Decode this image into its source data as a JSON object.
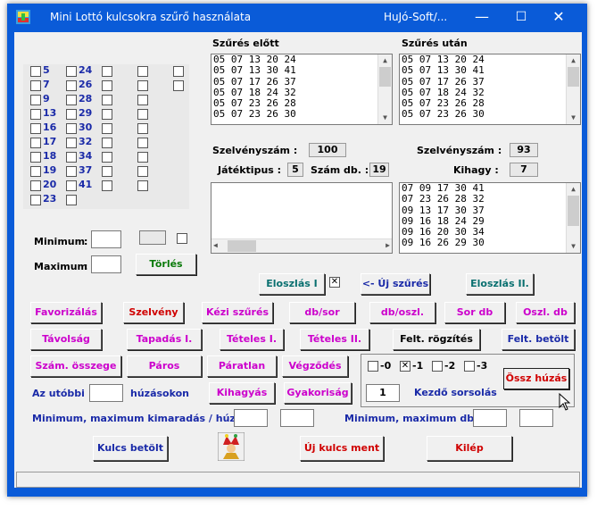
{
  "window": {
    "title": "Mini Lottó kulcsokra szűrő használata",
    "title_right": "HuJó-Soft/...",
    "minimize": "—",
    "maximize": "☐",
    "close": "✕"
  },
  "numbers_col1": [
    "5",
    "7",
    "9",
    "13",
    "16",
    "17",
    "18",
    "19",
    "20",
    "23"
  ],
  "numbers_col2": [
    "24",
    "26",
    "28",
    "29",
    "30",
    "32",
    "34",
    "37",
    "41"
  ],
  "filter_before": {
    "label": "Szűrés előtt",
    "rows": [
      "05 07 13 20 24",
      "05 07 13 30 41",
      "05 07 17 26 37",
      "05 07 18 24 32",
      "05 07 23 26 28",
      "05 07 23 26 30"
    ]
  },
  "filter_after": {
    "label": "Szűrés után",
    "rows": [
      "05 07 13 20 24",
      "05 07 13 30 41",
      "05 07 17 26 37",
      "05 07 18 24 32",
      "05 07 23 26 28",
      "05 07 23 26 30"
    ]
  },
  "stats": {
    "ticket_count_label": "Szelvényszám :",
    "ticket_count_before": "100",
    "game_type_label": "Játéktipus :",
    "game_type": "5",
    "num_count_label": "Szám db. :",
    "num_count": "19",
    "ticket_count_after_label": "Szelvényszám :",
    "ticket_count_after": "93",
    "skip_label": "Kihagy :",
    "skip": "7"
  },
  "skipped_list": [
    "07 09 17 30 41",
    "07 23 26 28 32",
    "09 13 17 30 37",
    "09 16 18 24 29",
    "09 16 20 30 34",
    "09 16 26 29 30"
  ],
  "minmax": {
    "min_label": "Minimum",
    "colon": ":",
    "max_label": "Maximum"
  },
  "buttons": {
    "torles": "Törlés",
    "eloszlas1": "Eloszlás I",
    "uj_szures": "<- Új szűrés",
    "eloszlas2": "Eloszlás II.",
    "favorizalas": "Favorizálás",
    "szelveny": "Szelvény",
    "kezi_szures": "Kézi szűrés",
    "db_sor": "db/sor",
    "db_oszl": "db/oszl.",
    "sor_db": "Sor db",
    "oszl_db": "Oszl. db",
    "tavolsag": "Távolság",
    "tapadas": "Tapadás I.",
    "teteles1": "Tételes I.",
    "teteles2": "Tételes II.",
    "felt_rogzites": "Felt. rögzítés",
    "felt_betolt": "Felt. betölt",
    "szam_osszege": "Szám. összege",
    "paros": "Páros",
    "paratlan": "Páratlan",
    "vegzodes": "Végződés",
    "kihagyas": "Kihagyás",
    "gyakorisag": "Gyakoriság",
    "ossz_huzas": "Össz húzás",
    "kulcs_betolt": "Kulcs betölt",
    "uj_kulcs_ment": "Új kulcs ment",
    "kilep": "Kilép"
  },
  "eloszlas_checkbox": "✕",
  "offsets": [
    {
      "label": "-0",
      "checked": false
    },
    {
      "label": "-1",
      "checked": true
    },
    {
      "label": "-2",
      "checked": false
    },
    {
      "label": "-3",
      "checked": false
    }
  ],
  "start_draw": {
    "value": "1",
    "label": "Kezdő sorsolás"
  },
  "last_draws": {
    "label": "Az utóbbi",
    "suffix": "húzásokon"
  },
  "bottom_labels": {
    "kimaradas": "Minimum, maximum kimaradás / húzás:",
    "maxdb": "Minimum, maximum db.:"
  }
}
